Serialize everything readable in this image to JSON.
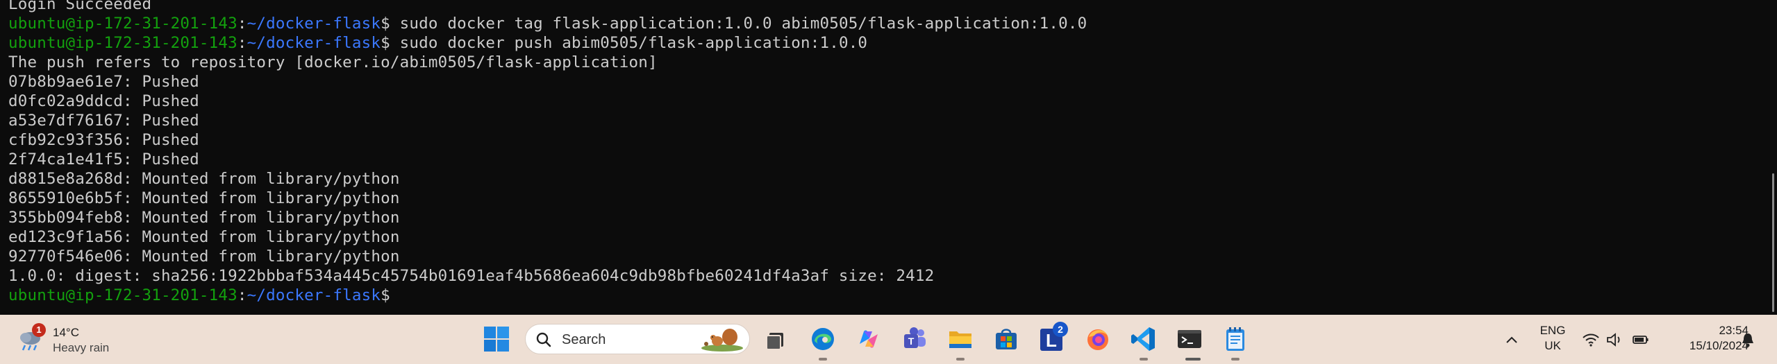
{
  "terminal": {
    "prompt_user": "ubuntu@ip-172-31-201-143",
    "prompt_sep": ":",
    "prompt_path": "~/docker-flask",
    "prompt_symbol": "$",
    "lines": [
      {
        "type": "output",
        "text": "Login Succeeded"
      },
      {
        "type": "prompt",
        "cmd": " sudo docker tag flask-application:1.0.0 abim0505/flask-application:1.0.0"
      },
      {
        "type": "prompt",
        "cmd": " sudo docker push abim0505/flask-application:1.0.0"
      },
      {
        "type": "output",
        "text": "The push refers to repository [docker.io/abim0505/flask-application]"
      },
      {
        "type": "output",
        "text": "07b8b9ae61e7: Pushed"
      },
      {
        "type": "output",
        "text": "d0fc02a9ddcd: Pushed"
      },
      {
        "type": "output",
        "text": "a53e7df76167: Pushed"
      },
      {
        "type": "output",
        "text": "cfb92c93f356: Pushed"
      },
      {
        "type": "output",
        "text": "2f74ca1e41f5: Pushed"
      },
      {
        "type": "output",
        "text": "d8815e8a268d: Mounted from library/python"
      },
      {
        "type": "output",
        "text": "8655910e6b5f: Mounted from library/python"
      },
      {
        "type": "output",
        "text": "355bb094feb8: Mounted from library/python"
      },
      {
        "type": "output",
        "text": "ed123c9f1a56: Mounted from library/python"
      },
      {
        "type": "output",
        "text": "92770f546e06: Mounted from library/python"
      },
      {
        "type": "output",
        "text": "1.0.0: digest: sha256:1922bbbaf534a445c45754b01691eaf4b5686ea604c9db98bfbe60241df4a3af size: 2412"
      },
      {
        "type": "prompt",
        "cmd": ""
      }
    ]
  },
  "taskbar": {
    "weather": {
      "temp": "14°C",
      "desc": "Heavy rain",
      "badge": "1"
    },
    "search": {
      "placeholder": "Search"
    },
    "apps": [
      {
        "name": "task-view"
      },
      {
        "name": "edge"
      },
      {
        "name": "copilot"
      },
      {
        "name": "teams"
      },
      {
        "name": "file-explorer"
      },
      {
        "name": "microsoft-store"
      },
      {
        "name": "l-app",
        "badge": "2"
      },
      {
        "name": "firefox"
      },
      {
        "name": "vscode"
      },
      {
        "name": "terminal"
      },
      {
        "name": "notepad"
      }
    ],
    "tray": {
      "lang_line1": "ENG",
      "lang_line2": "UK",
      "time": "23:54",
      "date": "15/10/2024"
    }
  },
  "colors": {
    "terminal_bg": "#0c0c0c",
    "terminal_fg": "#cccccc",
    "prompt_user": "#13a10e",
    "prompt_path": "#3b78ff",
    "taskbar_bg": "#eedfd4"
  }
}
